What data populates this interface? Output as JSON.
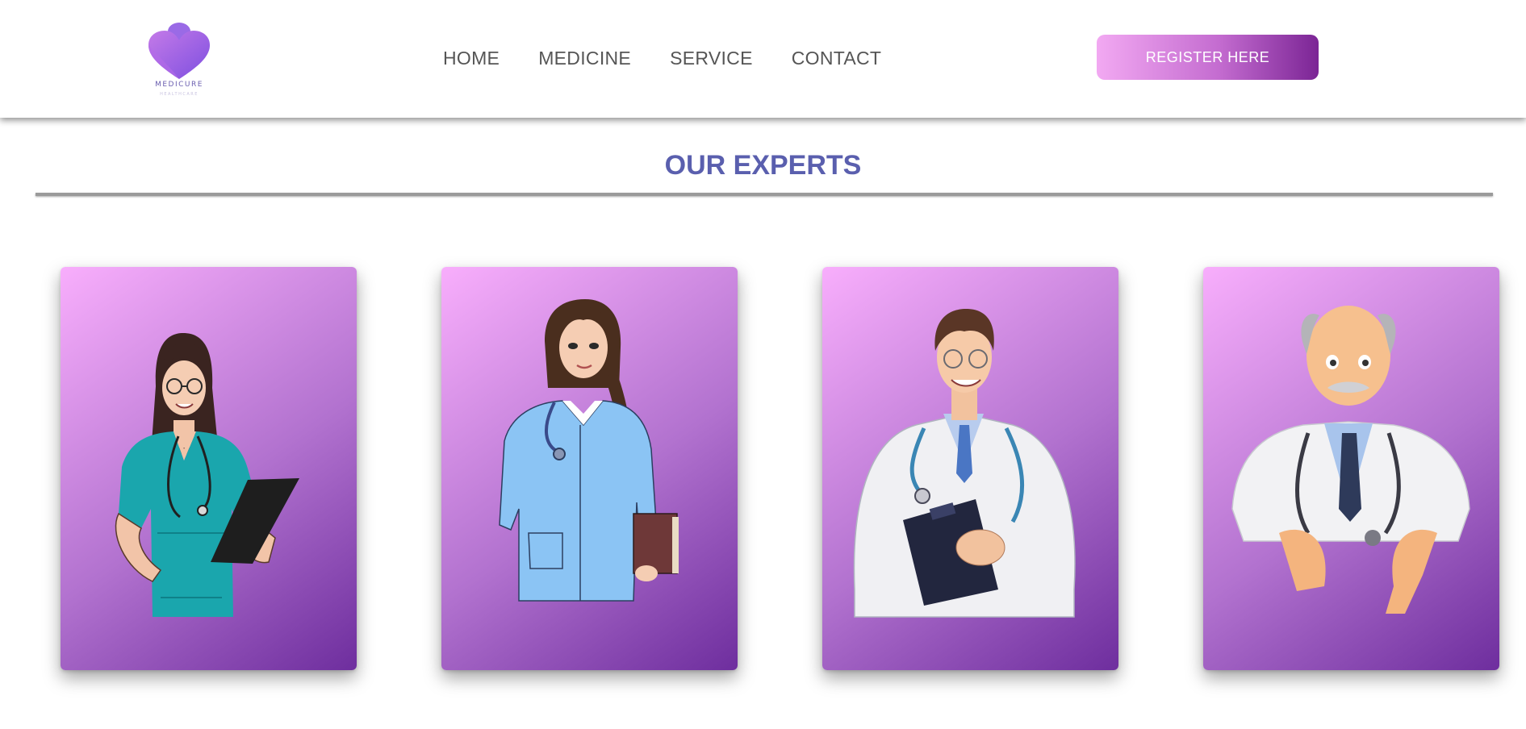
{
  "nav": {
    "logo": {
      "name": "MEDICURE",
      "tagline": "HEALTHCARE"
    },
    "links": [
      "HOME",
      "MEDICINE",
      "SERVICE",
      "CONTACT"
    ],
    "register_label": "REGISTER HERE"
  },
  "experts": {
    "title": "OUR EXPERTS",
    "cards": [
      {
        "illustration": "female-doctor-teal-scrubs-clipboard"
      },
      {
        "illustration": "female-doctor-blue-coat-braid-book"
      },
      {
        "illustration": "male-doctor-white-coat-clipboard"
      },
      {
        "illustration": "senior-doctor-3d-pointing"
      }
    ]
  },
  "colors": {
    "accent_purple": "#5a5fae",
    "button_gradient_start": "#f2a9f2",
    "button_gradient_end": "#7b2595",
    "card_gradient_start": "#f8aefc",
    "card_gradient_end": "#6e2e9e"
  }
}
